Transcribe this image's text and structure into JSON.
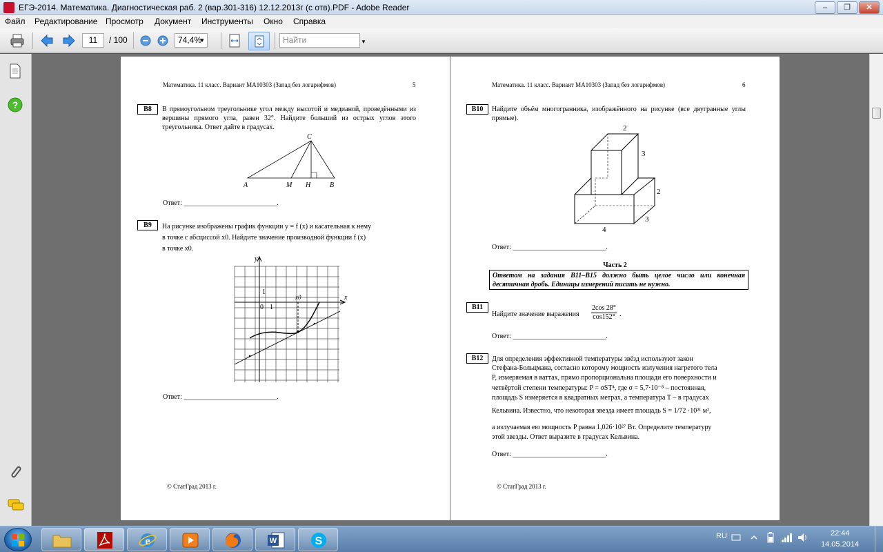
{
  "window": {
    "title": "ЕГЭ-2014. Математика. Диагностическая раб. 2 (вар.301-316) 12.12.2013г (с отв).PDF - Adobe Reader"
  },
  "menu": {
    "items": [
      "Файл",
      "Редактирование",
      "Просмотр",
      "Документ",
      "Инструменты",
      "Окно",
      "Справка"
    ]
  },
  "toolbar": {
    "page_current": "11",
    "page_total": "/ 100",
    "zoom": "74,4%",
    "find_placeholder": "Найти"
  },
  "left_page": {
    "header": "Математика. 11 класс. Вариант МА10303 (Запад без логарифмов)",
    "page_number": "5",
    "b8": {
      "label": "B8",
      "text": "В прямоугольном треугольнике угол между высотой и медианой, проведён­ными из вершины прямого угла, равен 32°. Найдите больший из острых углов этого треугольника. Ответ дайте в градусах.",
      "points": [
        "A",
        "M",
        "H",
        "B",
        "C"
      ]
    },
    "answer1": "Ответ: ___________________________.",
    "b9": {
      "label": "B9",
      "text_line1": "На рисунке изображены график функции  y = f (x)  и касательная к нему",
      "text_line2": "в точке с абсциссой  x0.  Найдите значение производной функции  f (x)",
      "text_line3": "в точке x0.",
      "axis_y": "y",
      "axis_x": "x",
      "tick_one_y": "1",
      "tick_zero": "0",
      "tick_one_x": "1",
      "x0_label": "x0"
    },
    "answer2": "Ответ: ___________________________.",
    "footer": "© СтатГрад 2013 г."
  },
  "right_page": {
    "header": "Математика. 11 класс. Вариант МА10303 (Запад без логарифмов)",
    "page_number": "6",
    "b10": {
      "label": "B10",
      "text": "Найдите объём многогранника, изображённого на рисунке (все двугранные углы прямые).",
      "dims": [
        "2",
        "3",
        "2",
        "4",
        "3"
      ]
    },
    "answer1": "Ответ: ___________________________.",
    "part2_title": "Часть 2",
    "part2_note": "Ответом на задания B11–B15 должно быть целое число или конечная десятичная дробь. Единицы измерений писать не нужно.",
    "b11": {
      "label": "B11",
      "text": "Найдите значение выражения",
      "numerator": "2cos 28°",
      "denominator": "cos152°",
      "dot": "."
    },
    "answer2": "Ответ: ___________________________.",
    "b12": {
      "label": "B12",
      "line1": "Для определения эффективной температуры звёзд используют закон",
      "line2": "Стефана-Больцмана, согласно которому мощность излучения нагретого тела",
      "line3": "P, измеряемая в ваттах, прямо пропорциональна площади его поверхности и",
      "line4": "четвёртой степени температуры:  P = σST⁴,  где  σ = 5,7·10⁻⁸  – постоянная,",
      "line5": "площадь  S  измеряется в квадратных метрах, а температура  T  – в градусах",
      "line6": "Кельвина. Известно, что некоторая звезда имеет площадь  S = 1/72 ·10²¹ м²,",
      "line7": "а излучаемая ею мощность  P  равна 1,026·10²⁷  Вт. Определите температуру",
      "line8": "этой звезды. Ответ выразите в градусах Кельвина."
    },
    "answer3": "Ответ: ___________________________.",
    "footer": "© СтатГрад 2013 г."
  },
  "taskbar": {
    "lang": "RU",
    "time": "22:44",
    "date": "14.05.2014"
  }
}
